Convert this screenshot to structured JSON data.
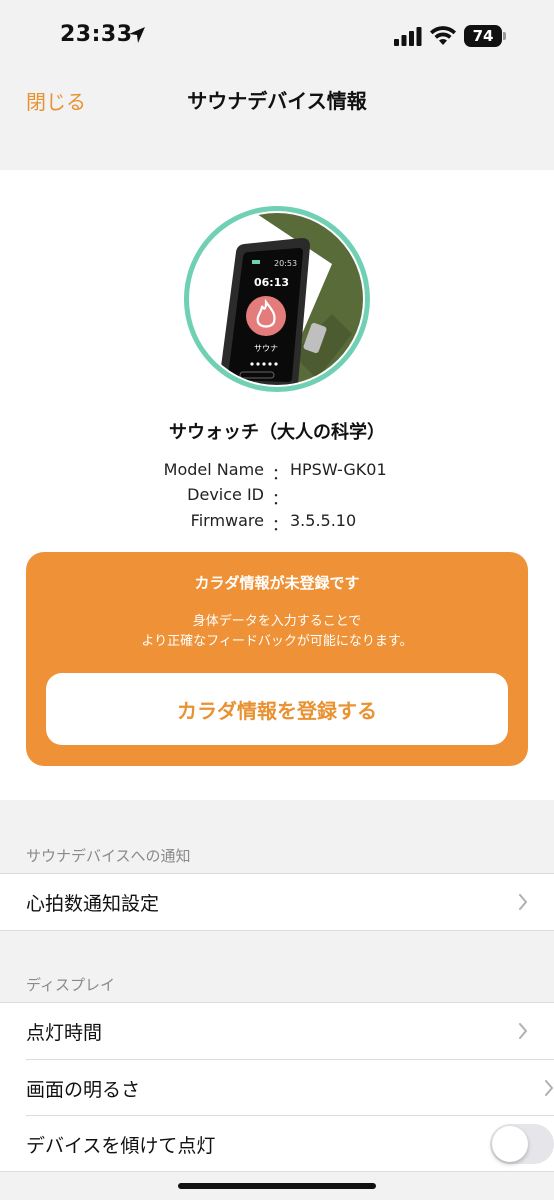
{
  "status_bar": {
    "time": "23:33",
    "battery": "74",
    "icons": [
      "location-arrow-icon",
      "signal-icon",
      "wifi-icon",
      "battery-icon"
    ]
  },
  "nav": {
    "close_label": "閉じる",
    "title": "サウナデバイス情報"
  },
  "device": {
    "name": "サウォッチ（大人の科学）",
    "screen_time_small": "20:53",
    "screen_time": "06:13",
    "screen_label": "サウナ",
    "info": [
      {
        "label": "Model Name",
        "sep": "：",
        "value": "HPSW-GK01"
      },
      {
        "label": "Device ID",
        "sep": "：",
        "value": ""
      },
      {
        "label": "Firmware",
        "sep": "：",
        "value": "3.5.5.10"
      }
    ]
  },
  "register_card": {
    "title": "カラダ情報が未登録です",
    "desc_line1": "身体データを入力することで",
    "desc_line2": "より正確なフィードバックが可能になります。",
    "button_label": "カラダ情報を登録する"
  },
  "sections": {
    "notify": {
      "header": "サウナデバイスへの通知",
      "items": [
        {
          "label": "心拍数通知設定"
        }
      ]
    },
    "display": {
      "header": "ディスプレイ",
      "items": [
        {
          "label": "点灯時間"
        },
        {
          "label": "画面の明るさ"
        },
        {
          "label": "デバイスを傾けて点灯",
          "toggle": false
        }
      ]
    }
  },
  "colors": {
    "accent": "#ef9237",
    "ring": "#6fd0b4",
    "band": "#5a6b3a"
  }
}
